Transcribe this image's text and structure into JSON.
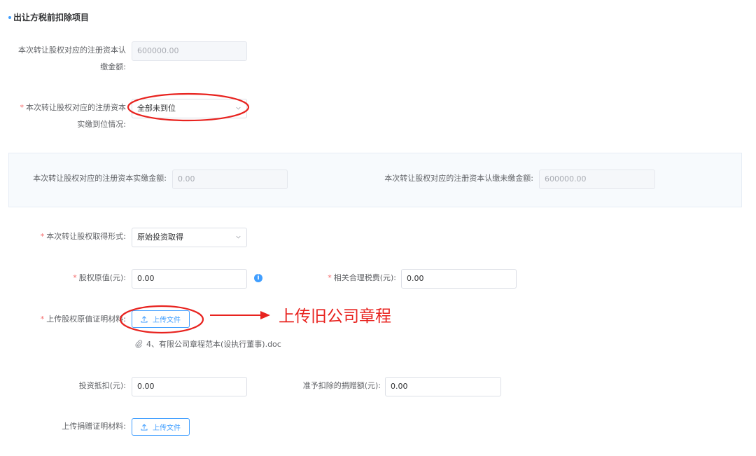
{
  "section": {
    "title": "出让方税前扣除项目"
  },
  "subscribed_capital": {
    "label_line1": "本次转让股权对应的注册资本认",
    "label_line2": "缴金额:",
    "value": "600000.00"
  },
  "paid_status": {
    "label_line1": "本次转让股权对应的注册资本",
    "label_line2": "实缴到位情况:",
    "value": "全部未到位"
  },
  "panel": {
    "paid_label": "本次转让股权对应的注册资本实缴金额:",
    "paid_value": "0.00",
    "unpaid_label": "本次转让股权对应的注册资本认缴未缴金额:",
    "unpaid_value": "600000.00"
  },
  "acquire_form": {
    "label": "本次转让股权取得形式:",
    "value": "原始投资取得"
  },
  "original_value": {
    "label": "股权原值(元):",
    "value": "0.00"
  },
  "related_taxes": {
    "label": "相关合理税费(元):",
    "value": "0.00"
  },
  "upload_proof": {
    "label": "上传股权原值证明材料:",
    "button": "上传文件",
    "file_name": "4、有限公司章程范本(设执行董事).doc"
  },
  "annotation": {
    "text": "上传旧公司章程",
    "color": "#e8231f"
  },
  "investment_deduction": {
    "label": "投资抵扣(元):",
    "value": "0.00"
  },
  "donation_deduction": {
    "label": "准予扣除的捐赠额(元):",
    "value": "0.00"
  },
  "upload_donation": {
    "label": "上传捐赠证明材料:",
    "button": "上传文件"
  },
  "colors": {
    "primary": "#409eff",
    "required": "#f56c6c",
    "annotation": "#e8231f"
  },
  "icons": [
    "info-icon",
    "upload-icon",
    "chevron-down-icon",
    "paperclip-icon"
  ]
}
